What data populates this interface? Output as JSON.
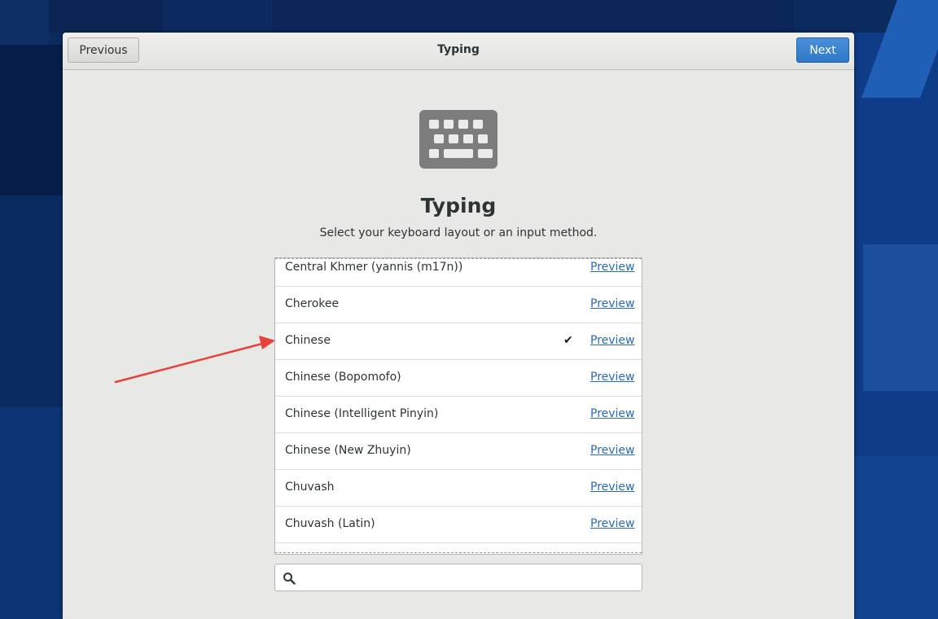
{
  "header": {
    "title": "Typing",
    "previous_label": "Previous",
    "next_label": "Next"
  },
  "page": {
    "icon": "keyboard-icon",
    "title": "Typing",
    "subtitle": "Select your keyboard layout or an input method."
  },
  "layouts": [
    {
      "label": "Central Khmer (yannis (m17n))",
      "preview": "Preview",
      "selected": false
    },
    {
      "label": "Cherokee",
      "preview": "Preview",
      "selected": false
    },
    {
      "label": "Chinese",
      "preview": "Preview",
      "selected": true
    },
    {
      "label": "Chinese (Bopomofo)",
      "preview": "Preview",
      "selected": false
    },
    {
      "label": "Chinese (Intelligent Pinyin)",
      "preview": "Preview",
      "selected": false
    },
    {
      "label": "Chinese (New Zhuyin)",
      "preview": "Preview",
      "selected": false
    },
    {
      "label": "Chuvash",
      "preview": "Preview",
      "selected": false
    },
    {
      "label": "Chuvash (Latin)",
      "preview": "Preview",
      "selected": false
    }
  ],
  "selected_mark": "✔",
  "search": {
    "icon": "search-icon",
    "value": "",
    "placeholder": ""
  },
  "colors": {
    "accent": "#3584e4",
    "link": "#2a6bb3",
    "annotation_arrow": "#e8403a"
  }
}
